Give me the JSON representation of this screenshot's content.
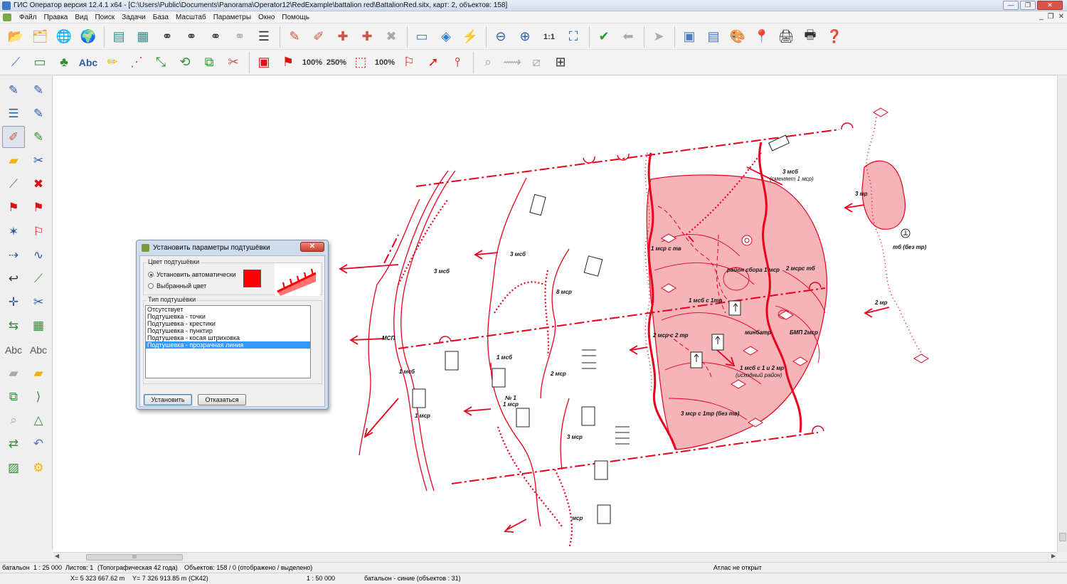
{
  "window": {
    "title": "ГИС Оператор версия 12.4.1 x64 - [C:\\Users\\Public\\Documents\\Panorama\\Operator12\\RedExample\\battalion red\\BattalionRed.sitx, карт: 2, объектов: 158]",
    "controls": [
      "—",
      "❐",
      "✕"
    ]
  },
  "menu": {
    "items": [
      "Файл",
      "Правка",
      "Вид",
      "Поиск",
      "Задачи",
      "База",
      "Масштаб",
      "Параметры",
      "Окно",
      "Помощь"
    ],
    "mdi_controls": [
      "_",
      "❐",
      "✕"
    ]
  },
  "toolbar1": {
    "zoom_ratio_label": "1:1"
  },
  "toolbar2": {
    "text_tool_label": "Abc",
    "scale_100_a": "100%",
    "scale_250": "250%",
    "scale_100_b": "100%"
  },
  "left_toolbar": {
    "abc_label_1": "Abc",
    "abc_label_2": "Abc"
  },
  "map": {
    "labels": {
      "msb3_top": "3 мсб",
      "msb3_replace": "(сменяет 1 мср)",
      "mr3": "3 мр",
      "tb": "тб (без тр)",
      "mr2": "2 мр",
      "msr1_tv": "1 мср с тв",
      "rayon_sbora": "район сбора 1 мср",
      "msrs2_tb": "2 мсрс тб",
      "msb1_tr": "1 мсб с 1тр",
      "msr2_tr": "2 мср с 2 тр",
      "minbatr": "минбатр",
      "bmp_2msr": "БМП 2мср",
      "msb1_1_2": "1 мсб с 1 и 2 мр",
      "ishodny": "(исходный район)",
      "msr3_tr": "3 мср с 1тр (без тв)",
      "msb3_left": "3 мсб",
      "msb3_mid": "3 мсб",
      "msr8": "8 мср",
      "msp": "МСП",
      "msb1_left": "1 мсб",
      "msb1_mid": "1 мсб",
      "msr2": "2 мср",
      "no1": "№ 1",
      "msr1_mid": "1 мср",
      "msr1_left": "1 мср",
      "msr3_bot": "3 мср",
      "msr_bot": "мср"
    }
  },
  "dialog": {
    "title": "Установить параметры подтушёвки",
    "close_label": "✕",
    "color_group_label": "Цвет подтушёвки",
    "radio_auto": "Установить автоматически",
    "radio_selected": "Выбранный цвет",
    "swatch_color": "#ff0000",
    "type_group_label": "Тип подтушёвки",
    "types": [
      "Отсутствует",
      "Подтушевка - точки",
      "Подтушевка - крестики",
      "Подтушевка - пунктир",
      "Подтушевка - косая штриховка",
      "Подтушевка - прозрачная линия"
    ],
    "selected_type_index": 5,
    "apply_button": "Установить",
    "cancel_button": "Отказаться"
  },
  "hscroll": {
    "thumb_label": "III"
  },
  "status1": {
    "map_name": "батальон",
    "scale": "1 : 25 000",
    "sheets": "Листов: 1",
    "map_type": "(Топографическая 42 года)",
    "objects": "Объектов: 158 / 0 (отображено / выделено)",
    "atlas": "Атлас не открыт"
  },
  "status2": {
    "x_coord": "X= 5 323 667.62 m",
    "y_coord": "Y= 7 326 913.85 m",
    "crs": "(СК42)",
    "view_scale": "1 : 50 000",
    "layer_info": "батальон - синие   (объектов : 31)"
  },
  "colors": {
    "accent_red": "#e8001c",
    "zone_fill": "#f6b3b8",
    "selection": "#3399ff"
  }
}
